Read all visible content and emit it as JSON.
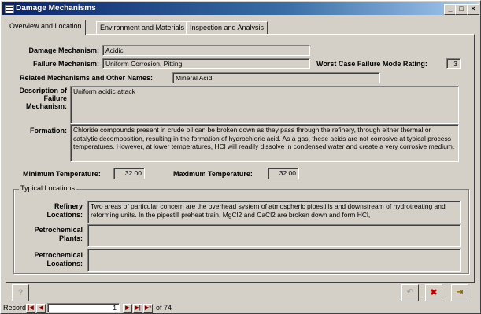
{
  "window": {
    "title": "Damage Mechanisms"
  },
  "tabs": [
    "Overview and Location",
    "Environment and Materials",
    "Inspection and Analysis"
  ],
  "fields": {
    "damage_mechanism_label": "Damage Mechanism:",
    "damage_mechanism_value": "Acidic",
    "failure_mechanism_label": "Failure Mechanism:",
    "failure_mechanism_value": "Uniform Corrosion, Pitting",
    "worst_case_label": "Worst Case Failure Mode Rating:",
    "worst_case_value": "3",
    "related_label": "Related Mechanisms and Other Names:",
    "related_value": "Mineral Acid",
    "description_label": "Description of Failure Mechanism:",
    "description_value": "Uniform acidic attack",
    "formation_label": "Formation:",
    "formation_value": "Chloride compounds present in crude oil can be broken down as they pass through the refinery, through either thermal or catalytic decomposition, resulting in the formation of hydrochloric acid.  As a gas, these acids are not corrosive at typical process temperatures.  However, at lower temperatures, HCl will readily dissolve in condensed water and create a very corrosive medium.",
    "min_temp_label": "Minimum Temperature:",
    "min_temp_value": "32.00",
    "max_temp_label": "Maximum Temperature:",
    "max_temp_value": "32.00"
  },
  "typical_locations": {
    "group_label": "Typical Locations",
    "refinery_label": "Refinery Locations:",
    "refinery_value": "Two areas of particular concern are the overhead system of atmospheric pipestills and downstream of hydrotreating and reforming units.  In the pipestill preheat train, MgCl2 and CaCl2 are broken down and form HCl,",
    "petrochemical_plants_label": "Petrochemical Plants:",
    "petrochemical_plants_value": "",
    "petrochemical_locations_label": "Petrochemical Locations:",
    "petrochemical_locations_value": ""
  },
  "record_nav": {
    "label": "Record:",
    "current": "1",
    "total_text": "of  74"
  },
  "icons": [
    "table-icon",
    "minimize-icon",
    "maximize-icon",
    "close-icon",
    "help-icon",
    "undo-icon",
    "delete-record-icon",
    "exit-icon"
  ]
}
